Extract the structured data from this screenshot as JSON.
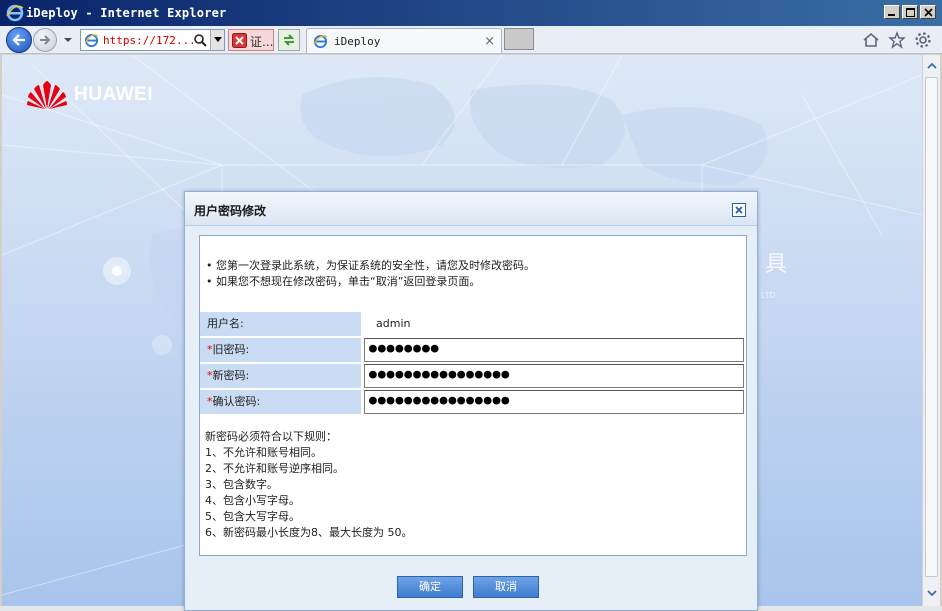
{
  "window": {
    "title": "iDeploy - Internet Explorer",
    "buttons": [
      "minimize",
      "maximize",
      "close"
    ]
  },
  "browser": {
    "address": "https://172...",
    "cert_label": "证...",
    "tab_title": "iDeploy",
    "tab_close": "×"
  },
  "page": {
    "brand": "HUAWEI",
    "bg_text": "具",
    "bg_small": "LTD"
  },
  "dialog": {
    "title": "用户密码修改",
    "notices": [
      "您第一次登录此系统，为保证系统的安全性，请您及时修改密码。",
      "如果您不想现在修改密码，单击“取消”返回登录页面。"
    ],
    "fields": [
      {
        "label": "用户名:",
        "required": false,
        "value": "admin",
        "type": "text"
      },
      {
        "label": "旧密码:",
        "required": true,
        "value": "●●●●●●●●",
        "type": "password"
      },
      {
        "label": "新密码:",
        "required": true,
        "value": "●●●●●●●●●●●●●●●●",
        "type": "password"
      },
      {
        "label": "确认密码:",
        "required": true,
        "value": "●●●●●●●●●●●●●●●●",
        "type": "password"
      }
    ],
    "rules_title": "新密码必须符合以下规则：",
    "rules": [
      "1、不允许和账号相同。",
      "2、不允许和账号逆序相同。",
      "3、包含数字。",
      "4、包含小写字母。",
      "5、包含大写字母。",
      "6、新密码最小长度为8、最大长度为 50。"
    ],
    "ok_label": "确定",
    "cancel_label": "取消"
  },
  "colors": {
    "titlebar": "#0a246a",
    "dialog_label_bg": "#c9dcf4",
    "button_blue": "#3e7cd0",
    "required_star": "#d00000",
    "brand_red": "#e60012"
  }
}
